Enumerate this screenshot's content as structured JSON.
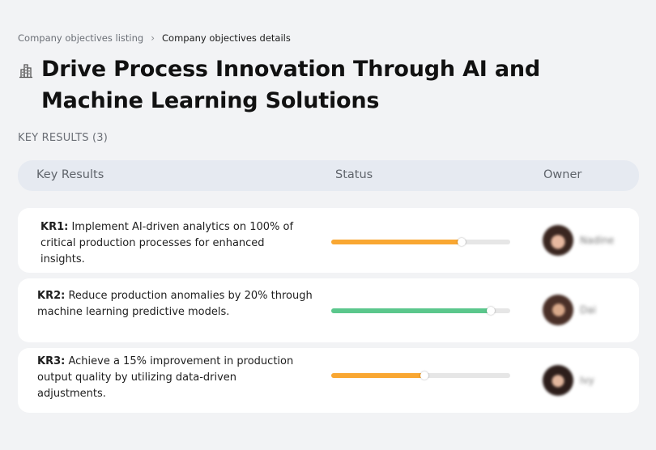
{
  "breadcrumb": {
    "parent": "Company objectives listing",
    "separator": "›",
    "current": "Company objectives details"
  },
  "objective": {
    "icon": "building-icon",
    "title": "Drive Process Innovation Through AI and Machine Learning Solutions"
  },
  "key_results_label": "KEY RESULTS (3)",
  "table": {
    "headers": {
      "key_results": "Key Results",
      "status": "Status",
      "owner": "Owner"
    }
  },
  "key_results": [
    {
      "code": "KR1:",
      "text": " Implement AI-driven analytics on 100% of critical production processes for enhanced insights.",
      "progress": 0.73,
      "color": "#f9a732",
      "owner": "Nadine"
    },
    {
      "code": "KR2:",
      "text": " Reduce production anomalies by 20% through machine learning predictive models.",
      "progress": 0.89,
      "color": "#5bc78c",
      "owner": "Dai"
    },
    {
      "code": "KR3:",
      "text": " Achieve a 15% improvement in production output quality by utilizing data-driven adjustments.",
      "progress": 0.52,
      "color": "#f9a732",
      "owner": "Ivy"
    }
  ]
}
